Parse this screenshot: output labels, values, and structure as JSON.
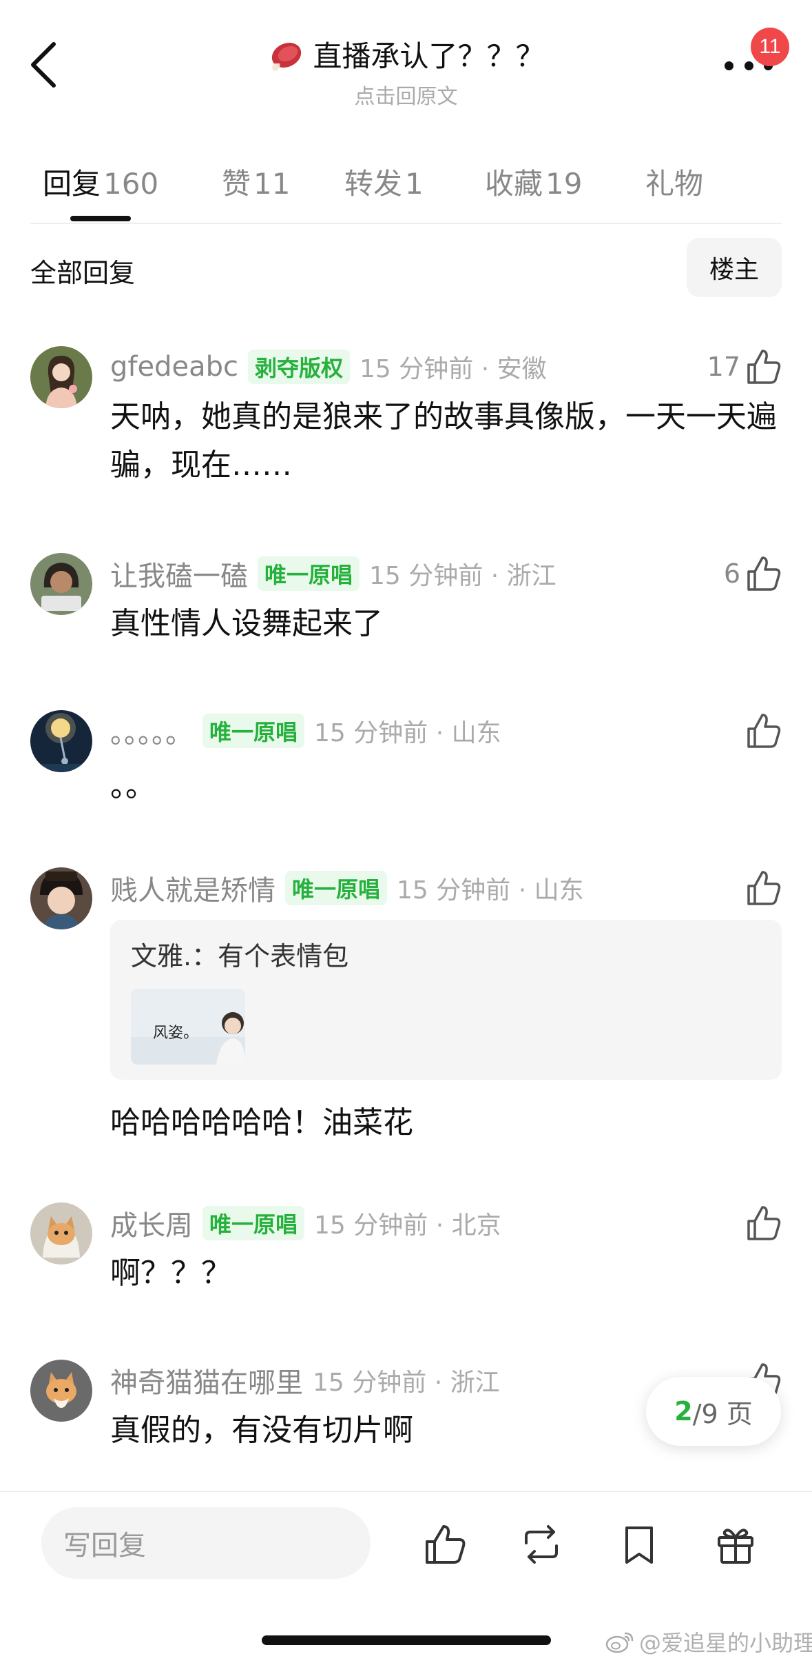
{
  "header": {
    "title": "直播承认了？？？",
    "subtitle": "点击回原文",
    "notification_count": "11"
  },
  "tabs": [
    {
      "label": "回复",
      "count": "160"
    },
    {
      "label": "赞",
      "count": "11"
    },
    {
      "label": "转发",
      "count": "1"
    },
    {
      "label": "收藏",
      "count": "19"
    },
    {
      "label": "礼物",
      "count": ""
    }
  ],
  "filter": {
    "label": "全部回复",
    "owner_button": "楼主"
  },
  "comments": [
    {
      "username": "gfedeabc",
      "tag": "剥夺版权",
      "meta": "15 分钟前 · 安徽",
      "likes": "17",
      "text": "天呐，她真的是狼来了的故事具像版，一天一天遍骗，现在……"
    },
    {
      "username": "让我磕一磕",
      "tag": "唯一原唱",
      "meta": "15 分钟前 · 浙江",
      "likes": "6",
      "text": "真性情人设舞起来了"
    },
    {
      "username": "。。。。。",
      "tag": "唯一原唱",
      "meta": "15 分钟前 · 山东",
      "likes": "",
      "text": "。。"
    },
    {
      "username": "贱人就是矫情",
      "tag": "唯一原唱",
      "meta": "15 分钟前 · 山东",
      "likes": "",
      "quote": "文雅.：有个表情包",
      "quote_image_text": "风姿。",
      "text": "哈哈哈哈哈哈！油菜花"
    },
    {
      "username": "成长周",
      "tag": "唯一原唱",
      "meta": "15 分钟前 · 北京",
      "likes": "",
      "text": "啊？？？"
    },
    {
      "username": "神奇猫猫在哪里",
      "tag": "",
      "meta": "15 分钟前 · 浙江",
      "likes": "",
      "text": "真假的，有没有切片啊"
    }
  ],
  "pagination": {
    "current": "2",
    "total": "/9 页"
  },
  "bottom_bar": {
    "reply_placeholder": "写回复",
    "icons": [
      "like-icon",
      "repost-icon",
      "bookmark-icon",
      "gift-icon"
    ]
  },
  "watermark": "@爱追星的小助理",
  "colors": {
    "tag_green": "#25b13c",
    "tag_bg": "#e9f9ec",
    "badge_red": "#f0484a"
  }
}
